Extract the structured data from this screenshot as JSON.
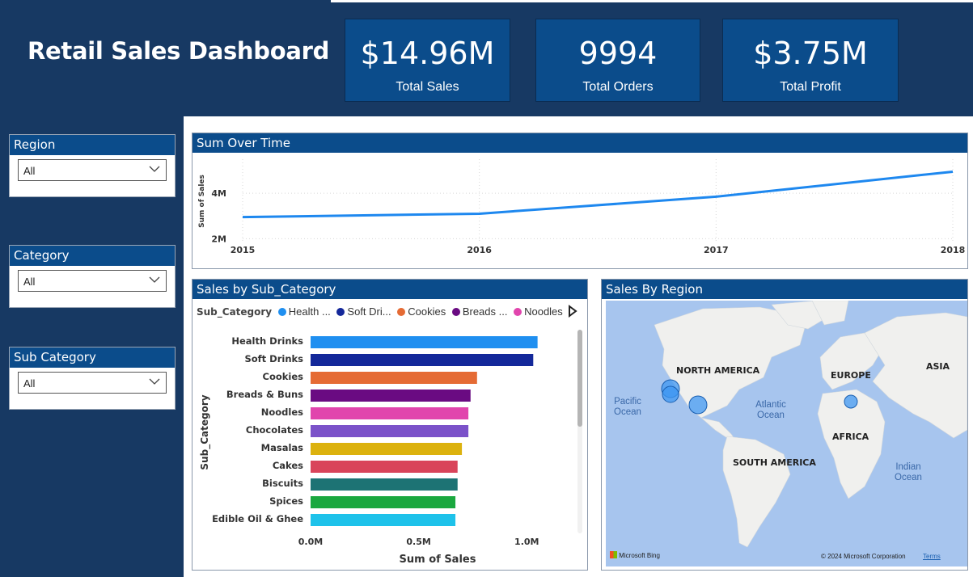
{
  "dashboard": {
    "title": "Retail Sales Dashboard"
  },
  "kpis": [
    {
      "value": "$14.96M",
      "label": "Total Sales"
    },
    {
      "value": "9994",
      "label": "Total Orders"
    },
    {
      "value": "$3.75M",
      "label": "Total Profit"
    }
  ],
  "slicers": [
    {
      "title": "Region",
      "value": "All"
    },
    {
      "title": "Category",
      "value": "All"
    },
    {
      "title": "Sub Category",
      "value": "All"
    }
  ],
  "line_panel": {
    "title": "Sum Over Time"
  },
  "bar_panel": {
    "title": "Sales by Sub_Category"
  },
  "map_panel": {
    "title": "Sales By Region",
    "continents": [
      "NORTH AMERICA",
      "EUROPE",
      "ASIA",
      "AFRICA",
      "SOUTH AMERICA"
    ],
    "oceans": [
      "Pacific Ocean",
      "Atlantic Ocean",
      "Indian Ocean"
    ],
    "bing_label": "Microsoft Bing",
    "copyright": "© 2024 Microsoft Corporation",
    "terms": "Terms",
    "land_color": "#f0f0ee",
    "water_color": "#a7c5ee",
    "bubble_color": "#3f97f2"
  },
  "chart_data": [
    {
      "type": "line",
      "title": "Sum Over Time",
      "xlabel": "",
      "ylabel": "Sum of Sales",
      "x": [
        "2015",
        "2016",
        "2017",
        "2018"
      ],
      "y_ticks": [
        "2M",
        "4M"
      ],
      "ylim": [
        1.8,
        5.5
      ],
      "series": [
        {
          "values": [
            2.95,
            3.1,
            3.85,
            4.95
          ]
        }
      ],
      "grid": true,
      "line_color": "#1e88ef"
    },
    {
      "type": "bar",
      "orientation": "horizontal",
      "title": "Sales by Sub_Category",
      "xlabel": "Sum of Sales",
      "ylabel": "Sub_Category",
      "legend_title": "Sub_Category",
      "legend": [
        "Health ...",
        "Soft Dri...",
        "Cookies",
        "Breads ...",
        "Noodles"
      ],
      "x_ticks": [
        "0.0M",
        "0.5M",
        "1.0M"
      ],
      "xlim": [
        0,
        1.1
      ],
      "categories": [
        "Health Drinks",
        "Soft Drinks",
        "Cookies",
        "Breads & Buns",
        "Noodles",
        "Chocolates",
        "Masalas",
        "Cakes",
        "Biscuits",
        "Spices",
        "Edible Oil & Ghee"
      ],
      "values": [
        1.05,
        1.03,
        0.77,
        0.74,
        0.73,
        0.73,
        0.7,
        0.68,
        0.68,
        0.67,
        0.67
      ],
      "colors": [
        "#1f8ff0",
        "#14289a",
        "#e56b34",
        "#6a0b82",
        "#e145ad",
        "#7b52c9",
        "#dcb20e",
        "#d9445a",
        "#1d7374",
        "#1aa83f",
        "#1ec2ea"
      ]
    }
  ]
}
